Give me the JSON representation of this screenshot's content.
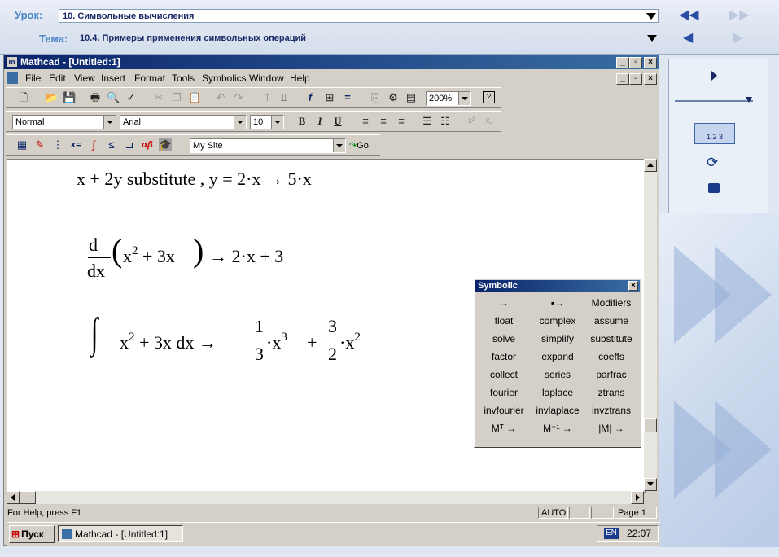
{
  "lesson_bar": {
    "lesson_label": "Урок:",
    "lesson_value": "10. Символьные вычисления",
    "topic_label": "Тема:",
    "topic_value": "10.4. Примеры применения символьных операций",
    "nav_first": "◀◀",
    "nav_last": "▶▶",
    "nav_prev": "◀",
    "nav_next": "▶"
  },
  "mathcad": {
    "title": "Mathcad - [Untitled:1]",
    "menu": [
      "File",
      "Edit",
      "View",
      "Insert",
      "Format",
      "Tools",
      "Symbolics",
      "Window",
      "Help"
    ],
    "zoom": "200%",
    "style": "Normal",
    "font": "Arial",
    "font_size": "10",
    "bold": "B",
    "italic": "I",
    "underline": "U",
    "resource": "My Site",
    "go": "Go",
    "status_help": "For Help, press F1",
    "status_mode": "AUTO",
    "status_page": "Page 1"
  },
  "worksheet": {
    "eq1": "x + 2y substitute , y = 2·x  → 5·x",
    "eq2_d": "d",
    "eq2_dx": "dx",
    "eq2_body": "x",
    "eq2_sup": "2",
    "eq2_rest": " + 3x",
    "eq2_result": "→ 2·x + 3",
    "eq3_integral": "∫",
    "eq3_x": "x",
    "eq3_sup1": "2",
    "eq3_rest": " + 3x dx →",
    "eq3_f1_num": "1",
    "eq3_f1_den": "3",
    "eq3_x3": "·x",
    "eq3_sup3": "3",
    "eq3_plus": "+",
    "eq3_f2_num": "3",
    "eq3_f2_den": "2",
    "eq3_x2": "·x",
    "eq3_sup2": "2"
  },
  "symbolic_palette": {
    "title": "Symbolic",
    "buttons": [
      "→",
      "▪→",
      "Modifiers",
      "float",
      "complex",
      "assume",
      "solve",
      "simplify",
      "substitute",
      "factor",
      "expand",
      "coeffs",
      "collect",
      "series",
      "parfrac",
      "fourier",
      "laplace",
      "ztrans",
      "invfourier",
      "invlaplace",
      "invztrans",
      "Mᵀ →",
      "M⁻¹ →",
      "|M| →"
    ]
  },
  "taskbar": {
    "start": "Пуск",
    "task": "Mathcad - [Untitled:1]",
    "lang": "EN",
    "clock": "22:07"
  }
}
